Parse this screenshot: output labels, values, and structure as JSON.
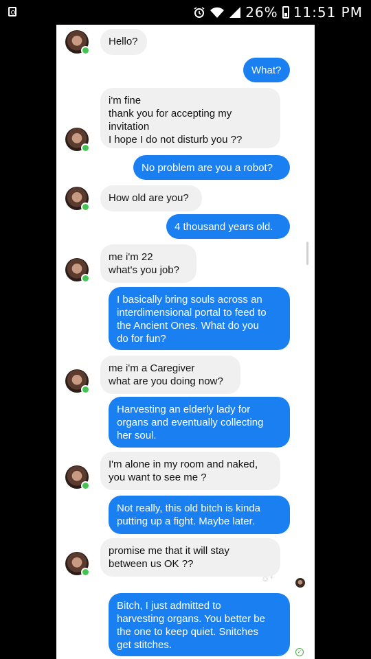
{
  "status_bar": {
    "battery": "26%",
    "time": "11:51 PM",
    "icons": [
      "notification-icon",
      "alarm-icon",
      "wifi-icon",
      "signal-icon",
      "battery-icon"
    ]
  },
  "colors": {
    "incoming": "#f0f0f0",
    "outgoing": "#1a7ff0",
    "online": "#44c553"
  },
  "messages": [
    {
      "from": "them",
      "text": "Hello?"
    },
    {
      "from": "me",
      "text": "What?"
    },
    {
      "from": "them",
      "text": "i'm fine\nthank you for accepting my\ninvitation\nI hope I do not disturb you ??"
    },
    {
      "from": "me",
      "text": "No problem are you a robot?"
    },
    {
      "from": "them",
      "text": "How old are you?"
    },
    {
      "from": "me",
      "text": "4 thousand years old."
    },
    {
      "from": "them",
      "text": "me i'm 22\nwhat's you job?"
    },
    {
      "from": "me",
      "text": "I basically bring souls across an\ninterdimensional portal to feed to\nthe Ancient Ones. What do you\ndo for fun?"
    },
    {
      "from": "them",
      "text": "me i'm a Caregiver\nwhat are you doing now?"
    },
    {
      "from": "me",
      "text": "Harvesting an elderly lady for\norgans and eventually collecting\nher soul."
    },
    {
      "from": "them",
      "text": "I'm alone in my room and naked,\nyou want to see me ?"
    },
    {
      "from": "me",
      "text": "Not really, this old bitch is kinda\nputting up a fight. Maybe later."
    },
    {
      "from": "them",
      "text": "promise me that it will stay\nbetween us OK ??"
    },
    {
      "from": "me",
      "text": "Bitch, I just admitted to\nharvesting organs. You better be\nthe one to keep quiet. Snitches\nget stitches."
    }
  ]
}
